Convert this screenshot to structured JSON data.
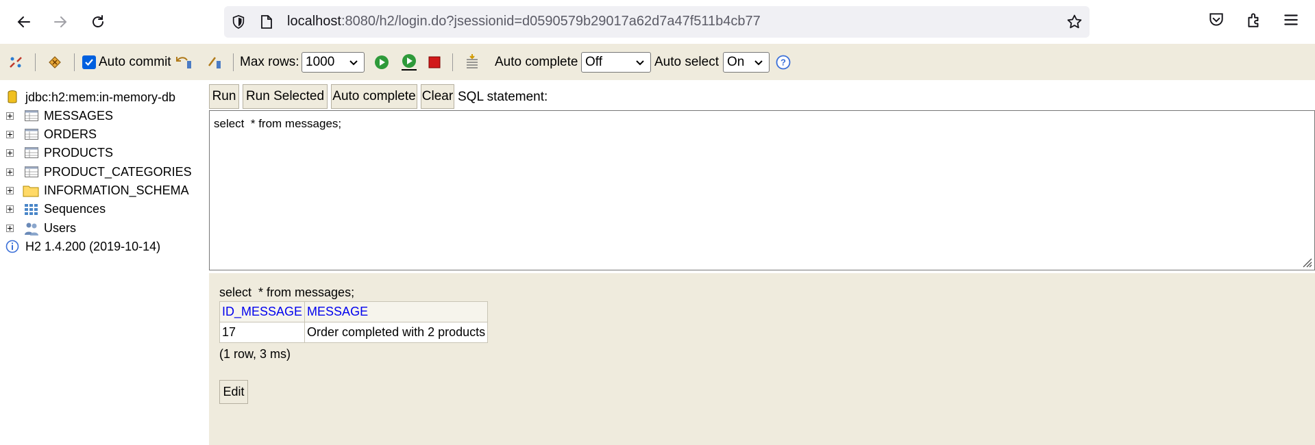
{
  "browser": {
    "url_host": "localhost",
    "url_rest": ":8080/h2/login.do?jsessionid=d0590579b29017a62d7a47f511b4cb77"
  },
  "toolbar": {
    "auto_commit_label": "Auto commit",
    "auto_commit_checked": true,
    "max_rows_label": "Max rows:",
    "max_rows_value": "1000",
    "auto_complete_label": "Auto complete",
    "auto_complete_value": "Off",
    "auto_select_label": "Auto select",
    "auto_select_value": "On"
  },
  "tree": {
    "connection": "jdbc:h2:mem:in-memory-db",
    "items": [
      {
        "label": "MESSAGES",
        "icon": "table-icon"
      },
      {
        "label": "ORDERS",
        "icon": "table-icon"
      },
      {
        "label": "PRODUCTS",
        "icon": "table-icon"
      },
      {
        "label": "PRODUCT_CATEGORIES",
        "icon": "table-icon"
      },
      {
        "label": "INFORMATION_SCHEMA",
        "icon": "folder-icon"
      },
      {
        "label": "Sequences",
        "icon": "sequences-icon"
      },
      {
        "label": "Users",
        "icon": "users-icon"
      }
    ],
    "version": "H2 1.4.200 (2019-10-14)"
  },
  "sql": {
    "run_label": "Run",
    "run_selected_label": "Run Selected",
    "auto_complete_label": "Auto complete",
    "clear_label": "Clear",
    "statement_label": "SQL statement:",
    "statement": "select  * from messages;"
  },
  "result": {
    "query": "select  * from messages;",
    "columns": [
      "ID_MESSAGE",
      "MESSAGE"
    ],
    "rows": [
      [
        "17",
        "Order completed with 2 products"
      ]
    ],
    "status": "(1 row, 3 ms)",
    "edit_label": "Edit"
  }
}
